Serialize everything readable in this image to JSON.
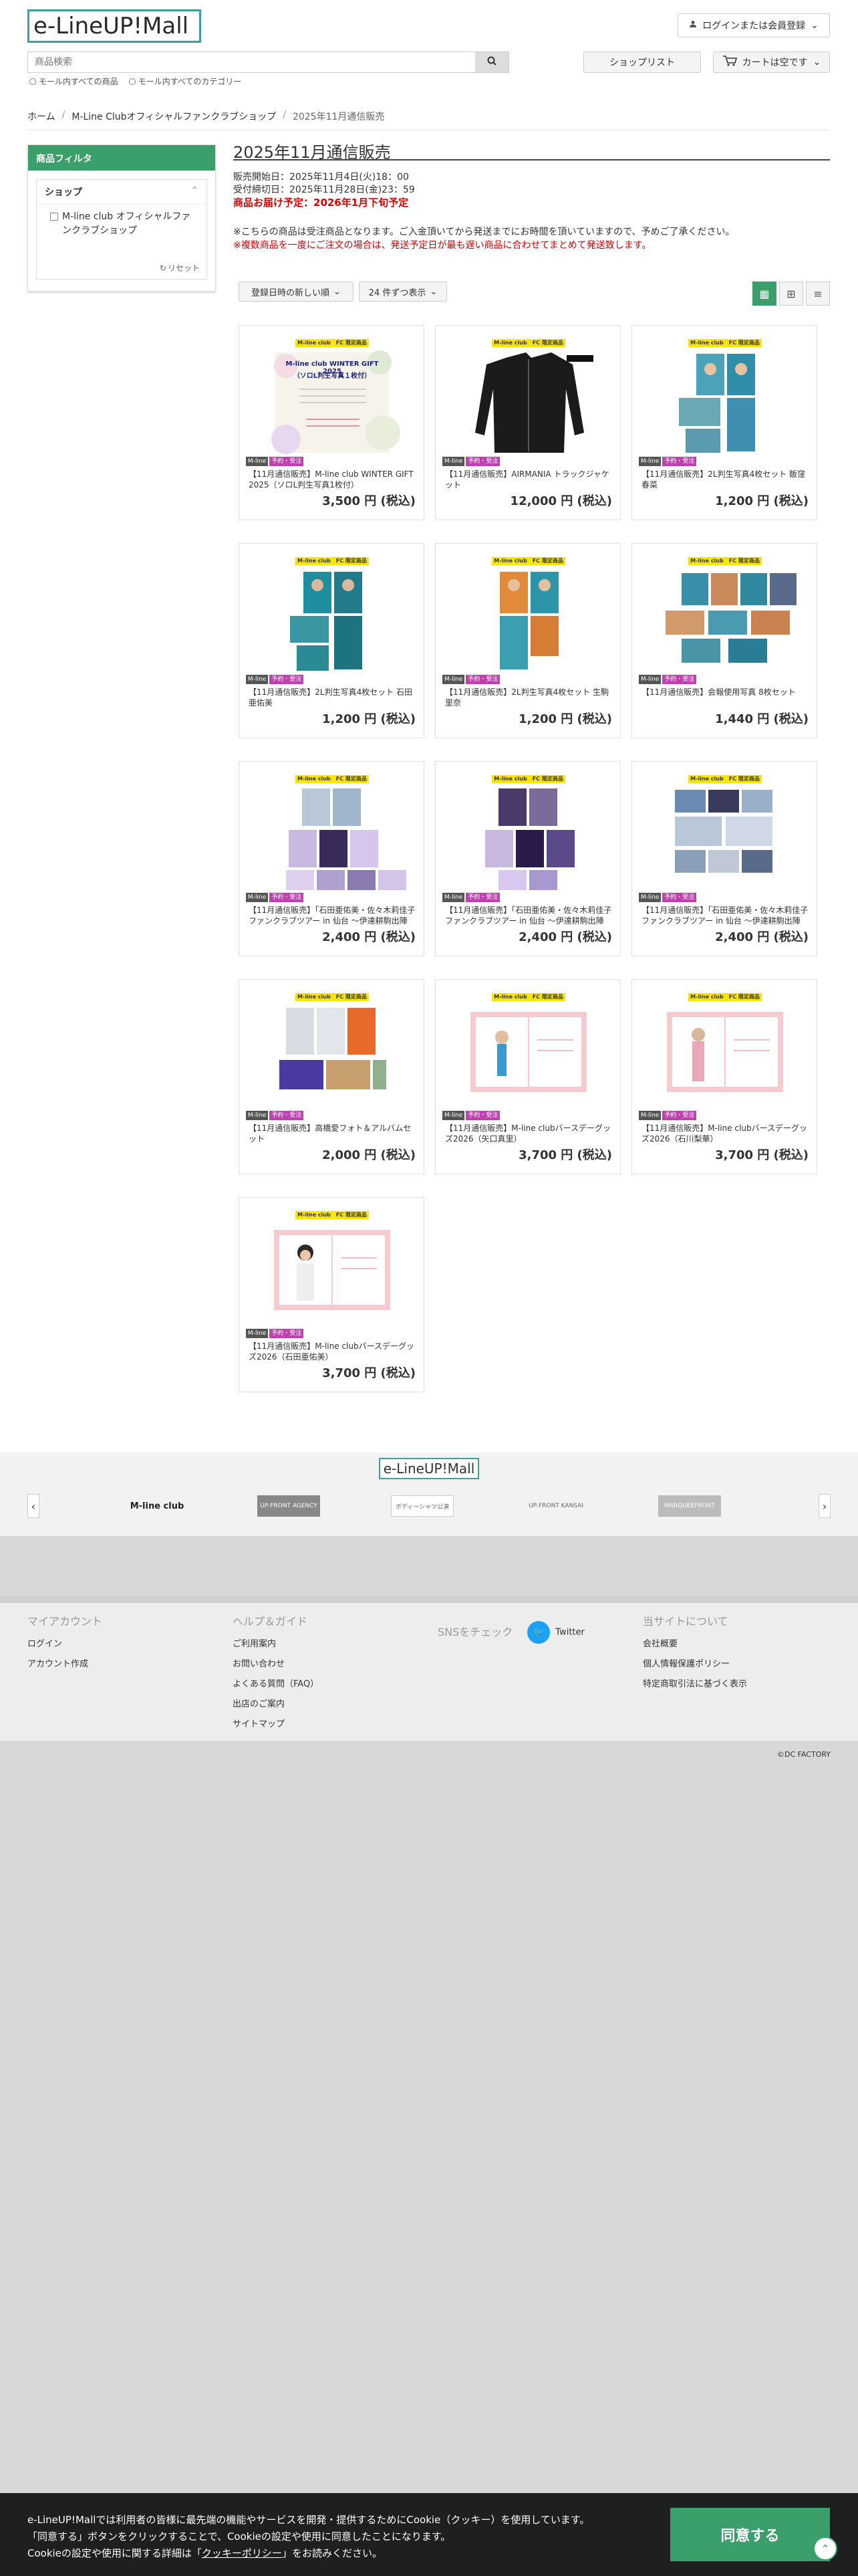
{
  "header": {
    "logo_text": "e-LineUP!Mall",
    "login_label": "ログインまたは会員登録",
    "search_placeholder": "商品検索",
    "scope_all_mall": "モール内すべての商品",
    "scope_all_categories": "モール内すべてのカテゴリー",
    "shoplist_label": "ショップリスト",
    "cart_label": "カートは空です"
  },
  "breadcrumb": [
    "ホーム",
    "M-Line Clubオフィシャルファンクラブショップ",
    "2025年11月通信販売"
  ],
  "sidebar": {
    "filter_title": "商品フィルタ",
    "group_title": "ショップ",
    "option_label": "M-line club オフィシャルファンクラブショップ",
    "reset_label": "リセット"
  },
  "main": {
    "title": "2025年11月通信販売",
    "sale_start": "販売開始日：2025年11月4日(火)18：00",
    "sale_end": "受付締切日：2025年11月28日(金)23：59",
    "delivery": "商品お届け予定：2026年1月下旬予定",
    "notice1": "※こちらの商品は受注商品となります。ご入金頂いてから発送までにお時間を頂いていますので、予めご了承ください。",
    "notice2": "※複数商品を一度にご注文の場合は、発送予定日が最も遅い商品に合わせてまとめて発送致します。",
    "sort_label": "登録日時の新しい順",
    "per_page_label": "24 件ずつ表示"
  },
  "badges": {
    "mline": "M-line",
    "yoyaku": "予約・受注",
    "fc": "M-line club　FC 限定商品"
  },
  "products": [
    {
      "name": "【11月通信販売】M-line club WINTER GIFT 2025（ソロL判生写真1枚付）",
      "price": "3,500 円 (税込)",
      "img_title": "M-line club WINTER GIFT 2025",
      "img_sub": "（ソロL判生写真１枚付）"
    },
    {
      "name": "【11月通信販売】AIRMANIA トラックジャケット",
      "price": "12,000 円 (税込)"
    },
    {
      "name": "【11月通信販売】2L判生写真4枚セット 飯窪春菜",
      "price": "1,200 円 (税込)"
    },
    {
      "name": "【11月通信販売】2L判生写真4枚セット 石田亜佑美",
      "price": "1,200 円 (税込)"
    },
    {
      "name": "【11月通信販売】2L判生写真4枚セット 生駒里奈",
      "price": "1,200 円 (税込)"
    },
    {
      "name": "【11月通信販売】会報使用写真 8枚セット",
      "price": "1,440 円 (税込)"
    },
    {
      "name": "【11月通信販売】「石田亜佑美・佐々木莉佳子 ファンクラブツアー in 仙台 〜伊達耕駒出陣",
      "price": "2,400 円 (税込)"
    },
    {
      "name": "【11月通信販売】「石田亜佑美・佐々木莉佳子 ファンクラブツアー in 仙台 〜伊達耕駒出陣",
      "price": "2,400 円 (税込)"
    },
    {
      "name": "【11月通信販売】「石田亜佑美・佐々木莉佳子 ファンクラブツアー in 仙台 〜伊達耕駒出陣",
      "price": "2,400 円 (税込)"
    },
    {
      "name": "【11月通信販売】高橋愛フォト＆アルバムセット",
      "price": "2,000 円 (税込)"
    },
    {
      "name": "【11月通信販売】M-line clubバースデーグッズ2026（矢口真里）",
      "price": "3,700 円 (税込)"
    },
    {
      "name": "【11月通信販売】M-line clubバースデーグッズ2026（石川梨華）",
      "price": "3,700 円 (税込)"
    },
    {
      "name": "【11月通信販売】M-line clubバースデーグッズ2026（石田亜佑美）",
      "price": "3,700 円 (税込)"
    }
  ],
  "brand_band": {
    "logo": "e-LineUP!Mall",
    "items": [
      "M-line club",
      "UP-FRONT AGENCY",
      "ボディーシャツ公演",
      "UP-FRONT KANSAI",
      "MARQUEEFRONT"
    ]
  },
  "footer": {
    "my_account": {
      "title": "マイアカウント",
      "links": [
        "ログイン",
        "アカウント作成"
      ]
    },
    "help": {
      "title": "ヘルプ＆ガイド",
      "links": [
        "ご利用案内",
        "お問い合わせ",
        "よくある質問（FAQ）",
        "出店のご案内",
        "サイトマップ"
      ]
    },
    "sns": {
      "title": "SNSをチェック",
      "twitter": "Twitter"
    },
    "about": {
      "title": "当サイトについて",
      "links": [
        "会社概要",
        "個人情報保護ポリシー",
        "特定商取引法に基づく表示"
      ]
    },
    "copyright": "©DC FACTORY"
  },
  "cookie": {
    "line1": "e-LineUP!Mallでは利用者の皆様に最先端の機能やサービスを開発・提供するためにCookie（クッキー）を使用しています。",
    "line2": "「同意する」ボタンをクリックすることで、Cookieの設定や使用に同意したことになります。",
    "line3_pre": "Cookieの設定や使用に関する詳細は「",
    "line3_link": "クッキーポリシー",
    "line3_post": "」をお読みください。",
    "agree_label": "同意する"
  },
  "colors": {
    "accent": "#3a9f6a",
    "price_red": "#dd0000",
    "fc_yellow": "#f8e500",
    "yoyaku_purple": "#c040b0"
  }
}
